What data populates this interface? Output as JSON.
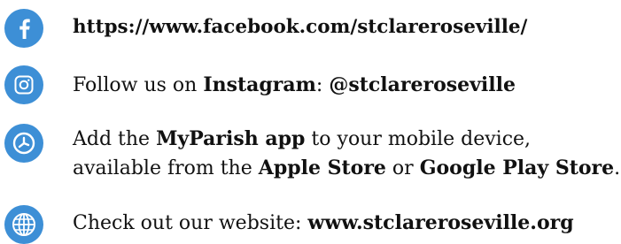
{
  "facebook": {
    "icon": "facebook-icon",
    "url": "https://www.facebook.com/stclareroseville/"
  },
  "instagram": {
    "icon": "instagram-icon",
    "prefix": "Follow us on ",
    "platform": "Instagram",
    "separator": ": ",
    "handle": "@stclareroseville"
  },
  "app": {
    "icon": "myparish-app-icon",
    "prefix": "Add the ",
    "app_name": "MyParish app",
    "suffix": " to your mobile device,",
    "line2_prefix": "available from the ",
    "store1": "Apple Store",
    "or_text": " or ",
    "store2": "Google Play Store",
    "end": "."
  },
  "website": {
    "icon": "globe-icon",
    "prefix": "Check out our website: ",
    "url": "www.stclareroseville.org"
  },
  "colors": {
    "icon_blue": "#3d8fd6",
    "text": "#111111"
  }
}
